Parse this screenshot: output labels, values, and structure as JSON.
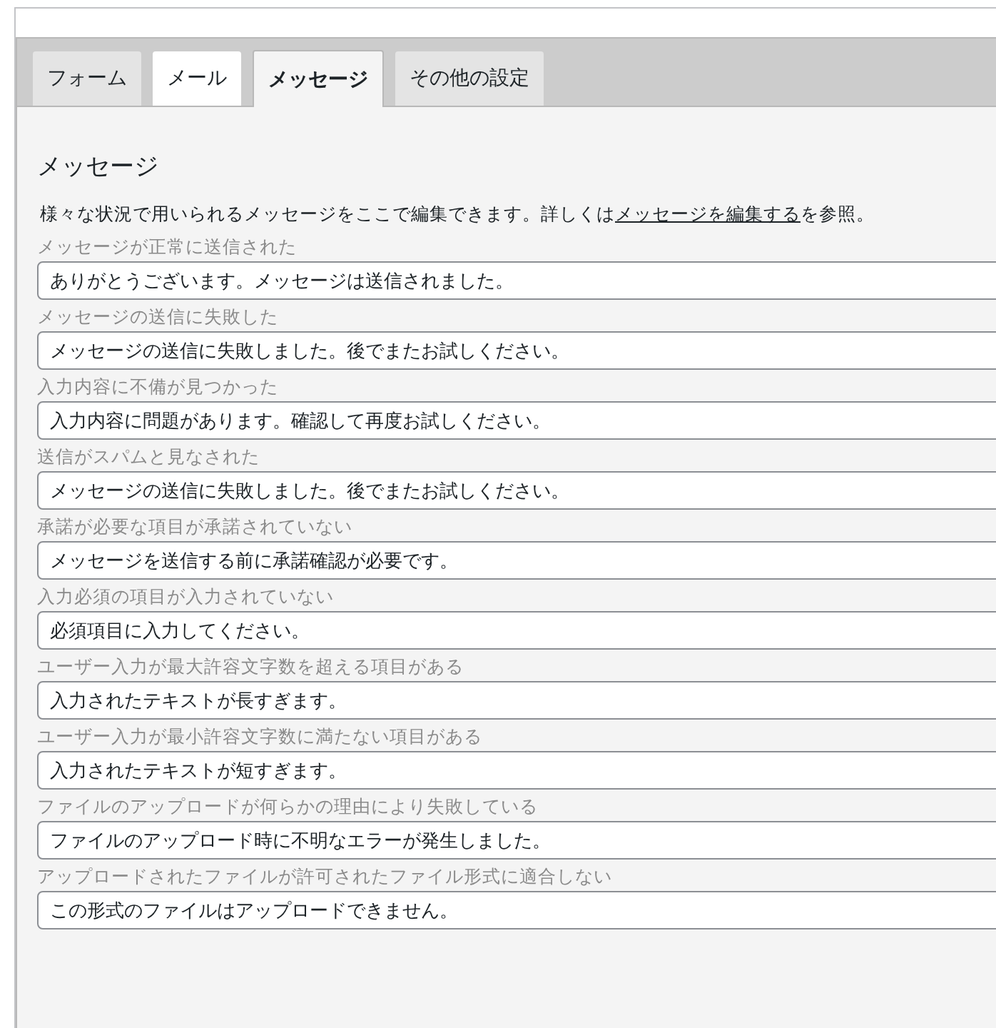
{
  "tabs": [
    {
      "label": "フォーム",
      "selected": false,
      "hovered": false
    },
    {
      "label": "メール",
      "selected": false,
      "hovered": true
    },
    {
      "label": "メッセージ",
      "selected": true,
      "hovered": false
    },
    {
      "label": "その他の設定",
      "selected": false,
      "hovered": false
    }
  ],
  "heading": "メッセージ",
  "description": {
    "before": "様々な状況で用いられるメッセージをここで編集できます。詳しくは",
    "link": "メッセージを編集する",
    "after": "を参照。"
  },
  "messages": [
    {
      "label": "メッセージが正常に送信された",
      "value": "ありがとうございます。メッセージは送信されました。"
    },
    {
      "label": "メッセージの送信に失敗した",
      "value": "メッセージの送信に失敗しました。後でまたお試しください。"
    },
    {
      "label": "入力内容に不備が見つかった",
      "value": "入力内容に問題があります。確認して再度お試しください。"
    },
    {
      "label": "送信がスパムと見なされた",
      "value": "メッセージの送信に失敗しました。後でまたお試しください。"
    },
    {
      "label": "承諾が必要な項目が承諾されていない",
      "value": "メッセージを送信する前に承諾確認が必要です。"
    },
    {
      "label": "入力必須の項目が入力されていない",
      "value": "必須項目に入力してください。"
    },
    {
      "label": "ユーザー入力が最大許容文字数を超える項目がある",
      "value": "入力されたテキストが長すぎます。"
    },
    {
      "label": "ユーザー入力が最小許容文字数に満たない項目がある",
      "value": "入力されたテキストが短すぎます。"
    },
    {
      "label": "ファイルのアップロードが何らかの理由により失敗している",
      "value": "ファイルのアップロード時に不明なエラーが発生しました。"
    },
    {
      "label": "アップロードされたファイルが許可されたファイル形式に適合しない",
      "value": "この形式のファイルはアップロードできません。"
    }
  ]
}
